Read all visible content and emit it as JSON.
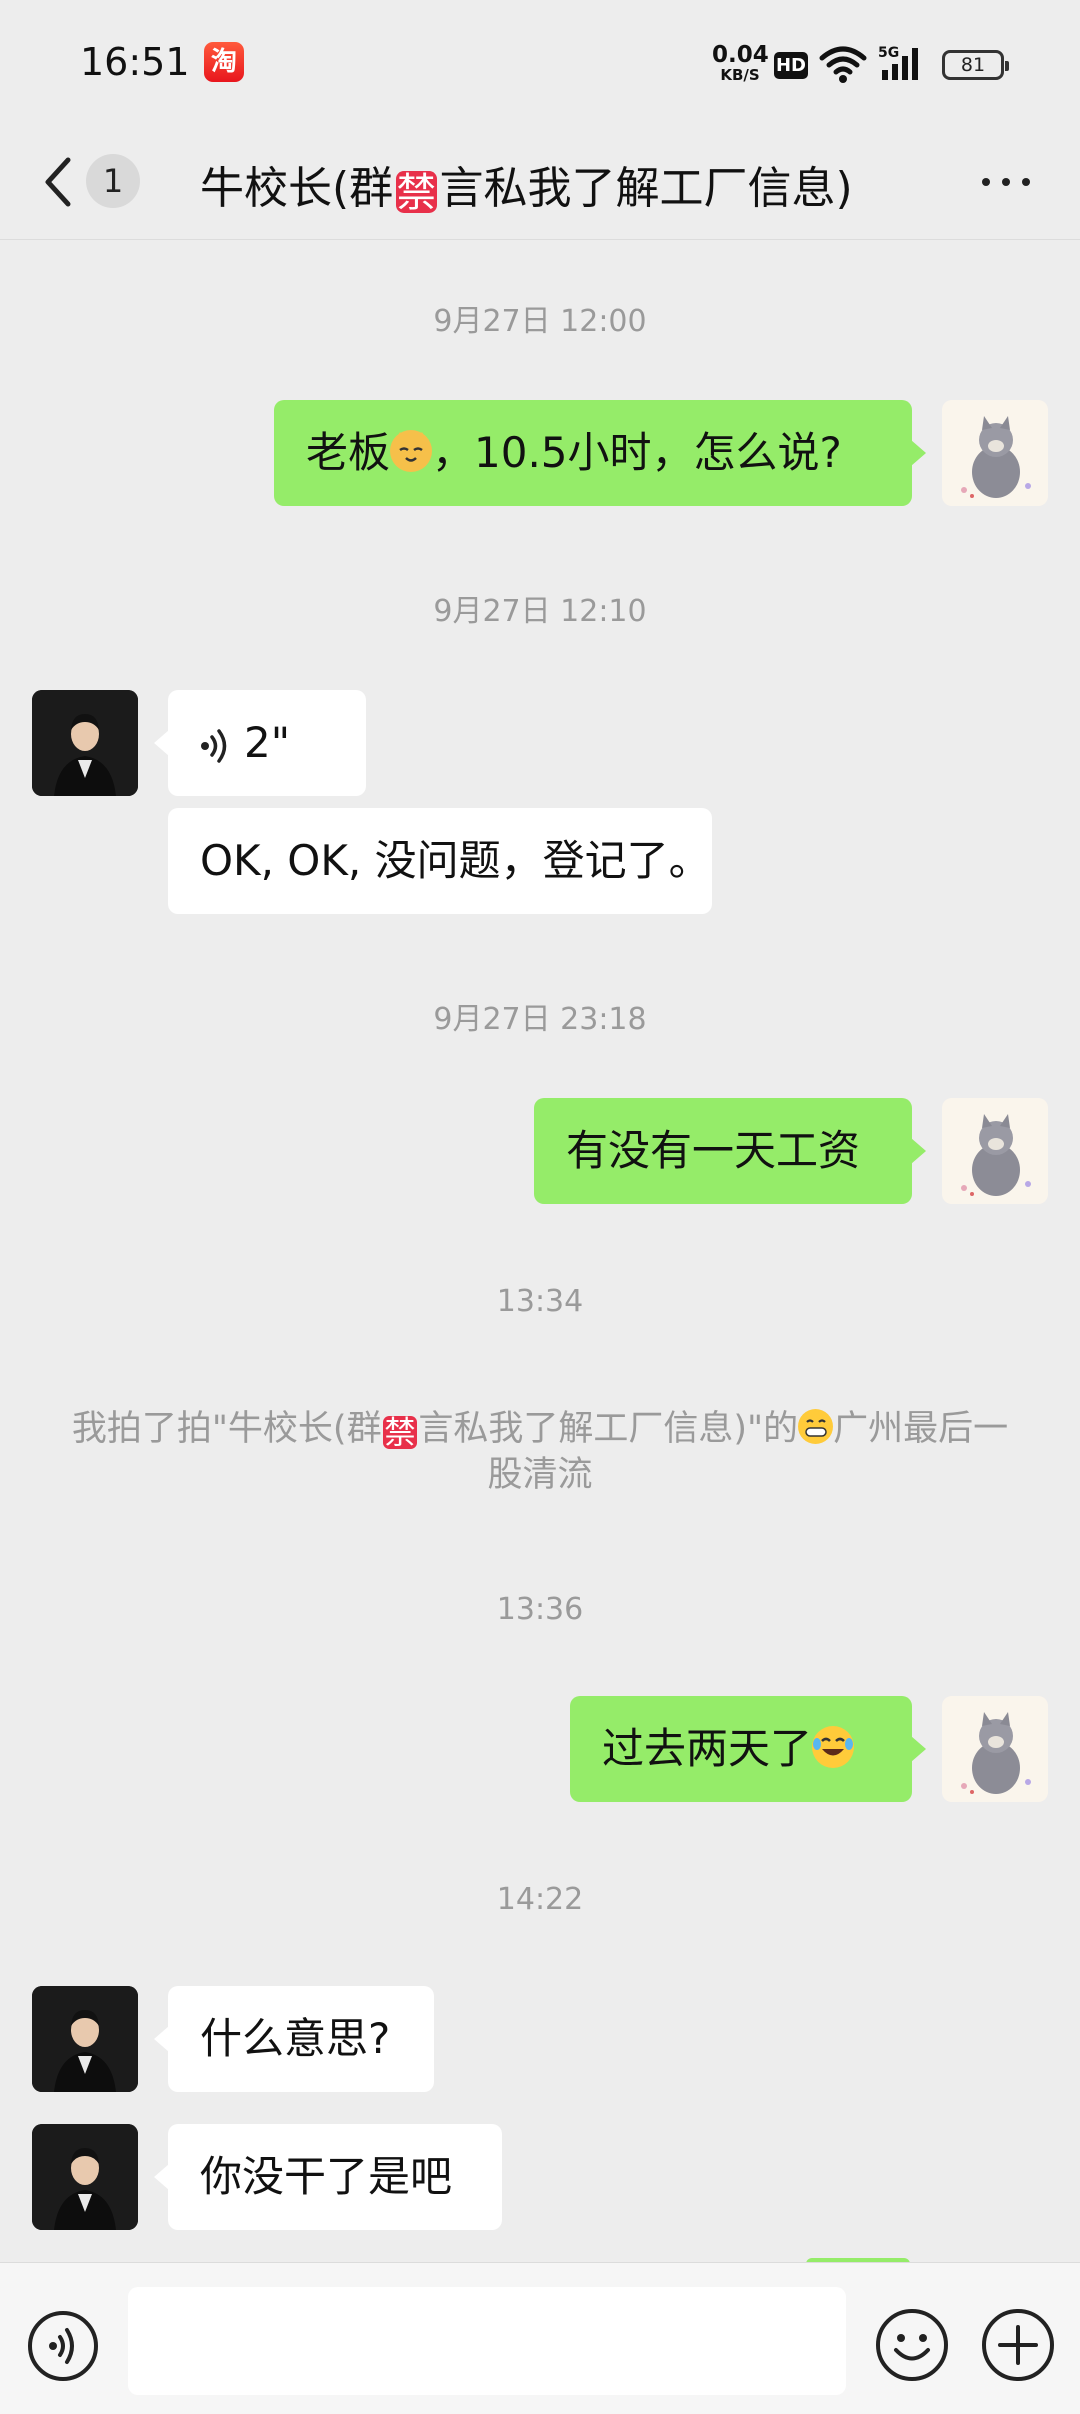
{
  "status_bar": {
    "time": "16:51",
    "app_icon_glyph": "淘",
    "net_speed_value": "0.04",
    "net_speed_unit": "KB/S",
    "hd_label": "HD",
    "signal_label": "5G",
    "battery": "81"
  },
  "header": {
    "unread_count": "1",
    "title_before": "牛校长(群",
    "title_ban_glyph": "禁",
    "title_after": "言私我了解工厂信息)"
  },
  "messages": {
    "t1": "9月27日 12:00",
    "m1_text_before": "老板",
    "m1_text_after": "，10.5小时，怎么说?",
    "t2": "9月27日 12:10",
    "m2_voice_duration": "2\"",
    "m3_text": "OK, OK, 没问题，登记了。",
    "t3": "9月27日 23:18",
    "m4_text": "有没有一天工资",
    "t4": "13:34",
    "sys_before": "我拍了拍\"牛校长(群",
    "sys_ban_glyph": "禁",
    "sys_middle": "言私我了解工厂信息)\"的",
    "sys_after": "广州最后一股清流",
    "t5": "13:36",
    "m5_text": "过去两天了",
    "t6": "14:22",
    "m6_text": "什么意思?",
    "m7_text": "你没干了是吧"
  },
  "colors": {
    "outgoing_bubble": "#95ec69",
    "incoming_bubble": "#ffffff",
    "background": "#ededed",
    "timestamp": "#9a9a9a"
  },
  "icons": {
    "back": "chevron-left-icon",
    "more": "more-dots-icon",
    "voice": "voice-icon",
    "emoji": "emoji-icon",
    "plus": "plus-icon"
  }
}
